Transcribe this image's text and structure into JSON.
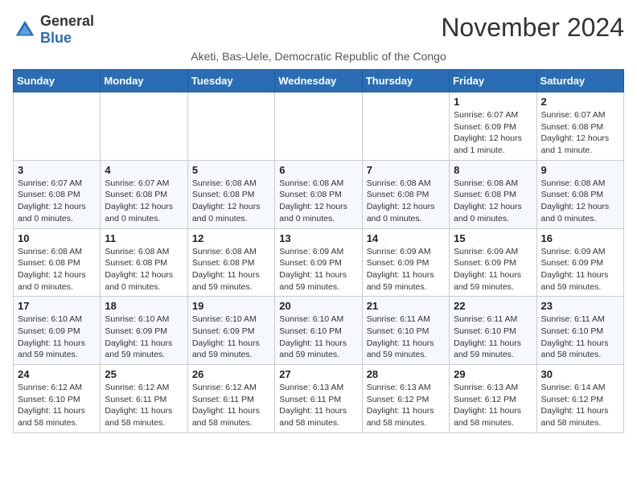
{
  "logo": {
    "general": "General",
    "blue": "Blue"
  },
  "title": "November 2024",
  "subtitle": "Aketi, Bas-Uele, Democratic Republic of the Congo",
  "weekdays": [
    "Sunday",
    "Monday",
    "Tuesday",
    "Wednesday",
    "Thursday",
    "Friday",
    "Saturday"
  ],
  "weeks": [
    [
      {
        "day": "",
        "info": ""
      },
      {
        "day": "",
        "info": ""
      },
      {
        "day": "",
        "info": ""
      },
      {
        "day": "",
        "info": ""
      },
      {
        "day": "",
        "info": ""
      },
      {
        "day": "1",
        "info": "Sunrise: 6:07 AM\nSunset: 6:09 PM\nDaylight: 12 hours\nand 1 minute."
      },
      {
        "day": "2",
        "info": "Sunrise: 6:07 AM\nSunset: 6:08 PM\nDaylight: 12 hours\nand 1 minute."
      }
    ],
    [
      {
        "day": "3",
        "info": "Sunrise: 6:07 AM\nSunset: 6:08 PM\nDaylight: 12 hours\nand 0 minutes."
      },
      {
        "day": "4",
        "info": "Sunrise: 6:07 AM\nSunset: 6:08 PM\nDaylight: 12 hours\nand 0 minutes."
      },
      {
        "day": "5",
        "info": "Sunrise: 6:08 AM\nSunset: 6:08 PM\nDaylight: 12 hours\nand 0 minutes."
      },
      {
        "day": "6",
        "info": "Sunrise: 6:08 AM\nSunset: 6:08 PM\nDaylight: 12 hours\nand 0 minutes."
      },
      {
        "day": "7",
        "info": "Sunrise: 6:08 AM\nSunset: 6:08 PM\nDaylight: 12 hours\nand 0 minutes."
      },
      {
        "day": "8",
        "info": "Sunrise: 6:08 AM\nSunset: 6:08 PM\nDaylight: 12 hours\nand 0 minutes."
      },
      {
        "day": "9",
        "info": "Sunrise: 6:08 AM\nSunset: 6:08 PM\nDaylight: 12 hours\nand 0 minutes."
      }
    ],
    [
      {
        "day": "10",
        "info": "Sunrise: 6:08 AM\nSunset: 6:08 PM\nDaylight: 12 hours\nand 0 minutes."
      },
      {
        "day": "11",
        "info": "Sunrise: 6:08 AM\nSunset: 6:08 PM\nDaylight: 12 hours\nand 0 minutes."
      },
      {
        "day": "12",
        "info": "Sunrise: 6:08 AM\nSunset: 6:08 PM\nDaylight: 11 hours\nand 59 minutes."
      },
      {
        "day": "13",
        "info": "Sunrise: 6:09 AM\nSunset: 6:09 PM\nDaylight: 11 hours\nand 59 minutes."
      },
      {
        "day": "14",
        "info": "Sunrise: 6:09 AM\nSunset: 6:09 PM\nDaylight: 11 hours\nand 59 minutes."
      },
      {
        "day": "15",
        "info": "Sunrise: 6:09 AM\nSunset: 6:09 PM\nDaylight: 11 hours\nand 59 minutes."
      },
      {
        "day": "16",
        "info": "Sunrise: 6:09 AM\nSunset: 6:09 PM\nDaylight: 11 hours\nand 59 minutes."
      }
    ],
    [
      {
        "day": "17",
        "info": "Sunrise: 6:10 AM\nSunset: 6:09 PM\nDaylight: 11 hours\nand 59 minutes."
      },
      {
        "day": "18",
        "info": "Sunrise: 6:10 AM\nSunset: 6:09 PM\nDaylight: 11 hours\nand 59 minutes."
      },
      {
        "day": "19",
        "info": "Sunrise: 6:10 AM\nSunset: 6:09 PM\nDaylight: 11 hours\nand 59 minutes."
      },
      {
        "day": "20",
        "info": "Sunrise: 6:10 AM\nSunset: 6:10 PM\nDaylight: 11 hours\nand 59 minutes."
      },
      {
        "day": "21",
        "info": "Sunrise: 6:11 AM\nSunset: 6:10 PM\nDaylight: 11 hours\nand 59 minutes."
      },
      {
        "day": "22",
        "info": "Sunrise: 6:11 AM\nSunset: 6:10 PM\nDaylight: 11 hours\nand 59 minutes."
      },
      {
        "day": "23",
        "info": "Sunrise: 6:11 AM\nSunset: 6:10 PM\nDaylight: 11 hours\nand 58 minutes."
      }
    ],
    [
      {
        "day": "24",
        "info": "Sunrise: 6:12 AM\nSunset: 6:10 PM\nDaylight: 11 hours\nand 58 minutes."
      },
      {
        "day": "25",
        "info": "Sunrise: 6:12 AM\nSunset: 6:11 PM\nDaylight: 11 hours\nand 58 minutes."
      },
      {
        "day": "26",
        "info": "Sunrise: 6:12 AM\nSunset: 6:11 PM\nDaylight: 11 hours\nand 58 minutes."
      },
      {
        "day": "27",
        "info": "Sunrise: 6:13 AM\nSunset: 6:11 PM\nDaylight: 11 hours\nand 58 minutes."
      },
      {
        "day": "28",
        "info": "Sunrise: 6:13 AM\nSunset: 6:12 PM\nDaylight: 11 hours\nand 58 minutes."
      },
      {
        "day": "29",
        "info": "Sunrise: 6:13 AM\nSunset: 6:12 PM\nDaylight: 11 hours\nand 58 minutes."
      },
      {
        "day": "30",
        "info": "Sunrise: 6:14 AM\nSunset: 6:12 PM\nDaylight: 11 hours\nand 58 minutes."
      }
    ]
  ]
}
